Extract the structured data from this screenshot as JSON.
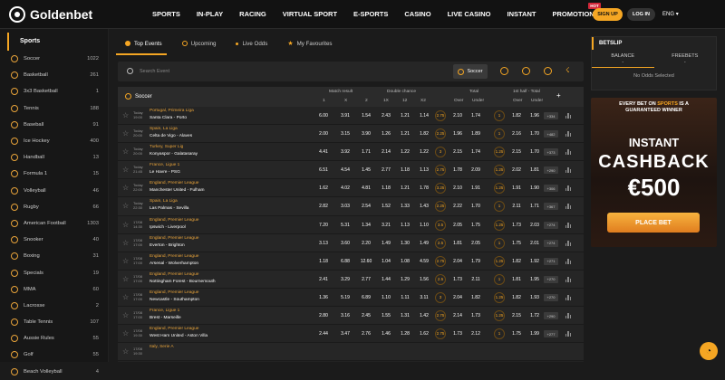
{
  "header": {
    "brand": "Goldenbet",
    "nav": [
      "SPORTS",
      "IN-PLAY",
      "RACING",
      "VIRTUAL SPORT",
      "E-SPORTS",
      "CASINO",
      "LIVE CASINO",
      "INSTANT",
      "PROMOTIONS"
    ],
    "hot_badge": "HOT",
    "signup": "SIGN UP",
    "login": "LOG IN",
    "lang": "ENG"
  },
  "sidebar": {
    "title": "Sports",
    "items": [
      {
        "name": "Soccer",
        "count": "1022"
      },
      {
        "name": "Basketball",
        "count": "261"
      },
      {
        "name": "3x3 Basketball",
        "count": "1"
      },
      {
        "name": "Tennis",
        "count": "188"
      },
      {
        "name": "Baseball",
        "count": "91"
      },
      {
        "name": "Ice Hockey",
        "count": "400"
      },
      {
        "name": "Handball",
        "count": "13"
      },
      {
        "name": "Formula 1",
        "count": "15"
      },
      {
        "name": "Volleyball",
        "count": "46"
      },
      {
        "name": "Rugby",
        "count": "66"
      },
      {
        "name": "American Football",
        "count": "1303"
      },
      {
        "name": "Snooker",
        "count": "40"
      },
      {
        "name": "Boxing",
        "count": "31"
      },
      {
        "name": "Specials",
        "count": "19"
      },
      {
        "name": "MMA",
        "count": "60"
      },
      {
        "name": "Lacrosse",
        "count": "2"
      },
      {
        "name": "Table Tennis",
        "count": "107"
      },
      {
        "name": "Aussie Rules",
        "count": "55"
      },
      {
        "name": "Golf",
        "count": "55"
      },
      {
        "name": "Beach Volleyball",
        "count": "4"
      }
    ]
  },
  "tabs": [
    "Top Events",
    "Upcoming",
    "Live Odds",
    "My Favourites"
  ],
  "search": {
    "placeholder": "Search Event",
    "sport": "Soccer"
  },
  "table": {
    "sport": "Soccer",
    "groups": [
      "Match result",
      "Double chance",
      "Total",
      "1st half - Total"
    ],
    "cols": [
      "1",
      "X",
      "2",
      "1X",
      "12",
      "X2",
      "Over",
      "Under",
      "Over",
      "Under"
    ],
    "rows": [
      {
        "time": "Today 19:00",
        "league": "Portugal, Primeira Liga",
        "teams": "Santa Clara - Porto",
        "odds": [
          "6.00",
          "3.91",
          "1.54",
          "2.43",
          "1.21",
          "1.14"
        ],
        "h": "2.75",
        "t": [
          "2.10",
          "1.74"
        ],
        "h2": "1",
        "t2": [
          "1.82",
          "1.96"
        ],
        "more": "+334"
      },
      {
        "time": "Today 20:00",
        "league": "Spain, La Liga",
        "teams": "Celta de Vigo - Alaves",
        "odds": [
          "2.00",
          "3.15",
          "3.90",
          "1.26",
          "1.21",
          "1.82"
        ],
        "h": "2.25",
        "t": [
          "1.96",
          "1.89"
        ],
        "h2": "1",
        "t2": [
          "2.16",
          "1.70"
        ],
        "more": "+482"
      },
      {
        "time": "Today 20:00",
        "league": "Turkey, Super Lig",
        "teams": "Konyaspor - Galatasaray",
        "odds": [
          "4.41",
          "3.92",
          "1.71",
          "2.14",
          "1.22",
          "1.22"
        ],
        "h": "3",
        "t": [
          "2.15",
          "1.74"
        ],
        "h2": "1.25",
        "t2": [
          "2.15",
          "1.70"
        ],
        "more": "+373"
      },
      {
        "time": "Today 21:45",
        "league": "France, Ligue 1",
        "teams": "Le Havre - PSG",
        "odds": [
          "6.51",
          "4.54",
          "1.45",
          "2.77",
          "1.18",
          "1.13"
        ],
        "h": "2.75",
        "t": [
          "1.78",
          "2.09"
        ],
        "h2": "1.25",
        "t2": [
          "2.02",
          "1.81"
        ],
        "more": "+290"
      },
      {
        "time": "Today 22:00",
        "league": "England, Premier League",
        "teams": "Manchester United - Fulham",
        "odds": [
          "1.62",
          "4.02",
          "4.81",
          "1.18",
          "1.21",
          "1.78"
        ],
        "h": "3.25",
        "t": [
          "2.10",
          "1.91"
        ],
        "h2": "1.25",
        "t2": [
          "1.91",
          "1.90"
        ],
        "more": "+306"
      },
      {
        "time": "Today 22:30",
        "league": "Spain, La Liga",
        "teams": "Las Palmas - Sevilla",
        "odds": [
          "2.82",
          "3.03",
          "2.54",
          "1.52",
          "1.33",
          "1.43"
        ],
        "h": "2.25",
        "t": [
          "2.22",
          "1.70"
        ],
        "h2": "1",
        "t2": [
          "2.11",
          "1.71"
        ],
        "more": "+367"
      },
      {
        "time": "17/08 14:30",
        "league": "England, Premier League",
        "teams": "Ipswich - Liverpool",
        "odds": [
          "7.20",
          "5.31",
          "1.34",
          "3.21",
          "1.13",
          "1.10"
        ],
        "h": "3.5",
        "t": [
          "2.05",
          "1.75"
        ],
        "h2": "1.25",
        "t2": [
          "1.73",
          "2.03"
        ],
        "more": "+274"
      },
      {
        "time": "17/08 17:00",
        "league": "England, Premier League",
        "teams": "Everton - Brighton",
        "odds": [
          "3.13",
          "3.60",
          "2.20",
          "1.49",
          "1.30",
          "1.49"
        ],
        "h": "2.5",
        "t": [
          "1.81",
          "2.05"
        ],
        "h2": "1",
        "t2": [
          "1.75",
          "2.01"
        ],
        "more": "+274"
      },
      {
        "time": "17/08 17:00",
        "league": "England, Premier League",
        "teams": "Arsenal - Wolverhampton",
        "odds": [
          "1.18",
          "6.88",
          "12.60",
          "1.04",
          "1.08",
          "4.59"
        ],
        "h": "2.75",
        "t": [
          "2.04",
          "1.79"
        ],
        "h2": "1.25",
        "t2": [
          "1.82",
          "1.92"
        ],
        "more": "+271"
      },
      {
        "time": "17/08 17:00",
        "league": "England, Premier League",
        "teams": "Nottingham Forest - Bournemouth",
        "odds": [
          "2.41",
          "3.29",
          "2.77",
          "1.44",
          "1.29",
          "1.56"
        ],
        "h": "2.5",
        "t": [
          "1.73",
          "2.11"
        ],
        "h2": "1",
        "t2": [
          "1.81",
          "1.95"
        ],
        "more": "+270"
      },
      {
        "time": "17/08 17:00",
        "league": "England, Premier League",
        "teams": "Newcastle - Southampton",
        "odds": [
          "1.36",
          "5.19",
          "6.89",
          "1.10",
          "1.11",
          "3.11"
        ],
        "h": "3",
        "t": [
          "2.04",
          "1.82"
        ],
        "h2": "1.25",
        "t2": [
          "1.82",
          "1.93"
        ],
        "more": "+270"
      },
      {
        "time": "17/08 17:00",
        "league": "France, Ligue 1",
        "teams": "Brest - Marseille",
        "odds": [
          "2.80",
          "3.16",
          "2.45",
          "1.55",
          "1.31",
          "1.42"
        ],
        "h": "2.75",
        "t": [
          "2.14",
          "1.73"
        ],
        "h2": "1.25",
        "t2": [
          "2.15",
          "1.72"
        ],
        "more": "+290"
      },
      {
        "time": "17/08 19:30",
        "league": "England, Premier League",
        "teams": "West Ham United - Aston Villa",
        "odds": [
          "2.44",
          "3.47",
          "2.76",
          "1.46",
          "1.28",
          "1.62"
        ],
        "h": "2.75",
        "t": [
          "1.73",
          "2.12"
        ],
        "h2": "1",
        "t2": [
          "1.75",
          "1.99"
        ],
        "more": "+277"
      },
      {
        "time": "17/08 19:30",
        "league": "Italy, Serie A",
        "teams": "",
        "odds": [
          "",
          "",
          "",
          "",
          "",
          ""
        ],
        "h": "",
        "t": [
          "",
          ""
        ],
        "h2": "",
        "t2": [
          "",
          ""
        ],
        "more": ""
      }
    ]
  },
  "betslip": {
    "title": "BETSLIP",
    "balance": "BALANCE",
    "balance_val": "-",
    "freebets": "FREEBETS",
    "freebets_val": "-",
    "empty": "No Odds Selected"
  },
  "promo": {
    "top1": "EVERY BET ON",
    "top_hl": "SPORTS",
    "top2": "IS A",
    "top3": "GUARANTEED WINNER",
    "instant": "INSTANT",
    "cashback": "CASHBACK",
    "amount": "€500",
    "button": "PLACE BET"
  },
  "colors": {
    "accent": "#f5a623",
    "league": "#e8a33a"
  }
}
